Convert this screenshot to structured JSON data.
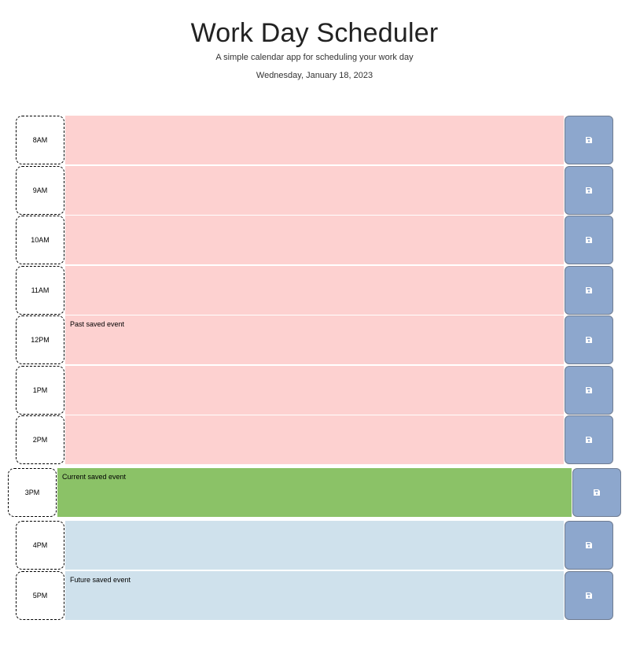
{
  "header": {
    "title": "Work Day Scheduler",
    "subtitle": "A simple calendar app for scheduling your work day",
    "date": "Wednesday, January 18, 2023"
  },
  "save_icon": "floppy-disk-icon",
  "colors": {
    "past": "#fdd1d0",
    "present": "#8bc267",
    "future": "#cfe1ec",
    "save_button": "#8da7cd"
  },
  "timeblocks": [
    {
      "hour": "8AM",
      "status": "past",
      "event": ""
    },
    {
      "hour": "9AM",
      "status": "past",
      "event": ""
    },
    {
      "hour": "10AM",
      "status": "past",
      "event": ""
    },
    {
      "hour": "11AM",
      "status": "past",
      "event": ""
    },
    {
      "hour": "12PM",
      "status": "past",
      "event": "Past saved event"
    },
    {
      "hour": "1PM",
      "status": "past",
      "event": ""
    },
    {
      "hour": "2PM",
      "status": "past",
      "event": ""
    },
    {
      "hour": "3PM",
      "status": "present",
      "event": "Current saved event"
    },
    {
      "hour": "4PM",
      "status": "future",
      "event": ""
    },
    {
      "hour": "5PM",
      "status": "future",
      "event": "Future saved event"
    }
  ]
}
